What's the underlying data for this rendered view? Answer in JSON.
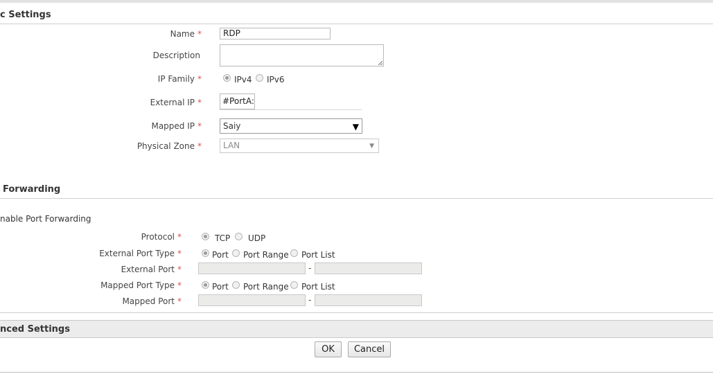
{
  "basic": {
    "title": "c Settings",
    "name_label": "Name",
    "name_value": "RDP",
    "description_label": "Description",
    "description_value": "",
    "ip_family_label": "IP Family",
    "ip_family_options": [
      "IPv4",
      "IPv6"
    ],
    "ip_family_selected": "IPv4",
    "external_ip_label": "External IP",
    "external_ip_value": "#PortA:",
    "mapped_ip_label": "Mapped IP",
    "mapped_ip_value": "Saiy",
    "zone_label": "Physical Zone",
    "zone_value": "LAN",
    "required_mark": "*"
  },
  "forwarding": {
    "title": "Forwarding",
    "enable_label": "nable Port Forwarding",
    "protocol_label": "Protocol",
    "protocol_options": [
      "TCP",
      "UDP"
    ],
    "protocol_selected": "TCP",
    "ext_port_type_label": "External Port Type",
    "port_type_options": [
      "Port",
      "Port Range",
      "Port List"
    ],
    "ext_port_type_selected": "Port",
    "ext_port_label": "External Port",
    "ext_port_from": "",
    "ext_port_to": "",
    "mapped_port_type_label": "Mapped Port Type",
    "mapped_port_type_selected": "Port",
    "mapped_port_label": "Mapped Port",
    "mapped_port_from": "",
    "mapped_port_to": "",
    "range_separator": "-"
  },
  "advanced": {
    "title": "nced Settings"
  },
  "buttons": {
    "ok": "OK",
    "cancel": "Cancel"
  },
  "colors": {
    "required": "#d9534f",
    "disabled_field": "#ebebe9",
    "section_bar": "#ececec"
  }
}
